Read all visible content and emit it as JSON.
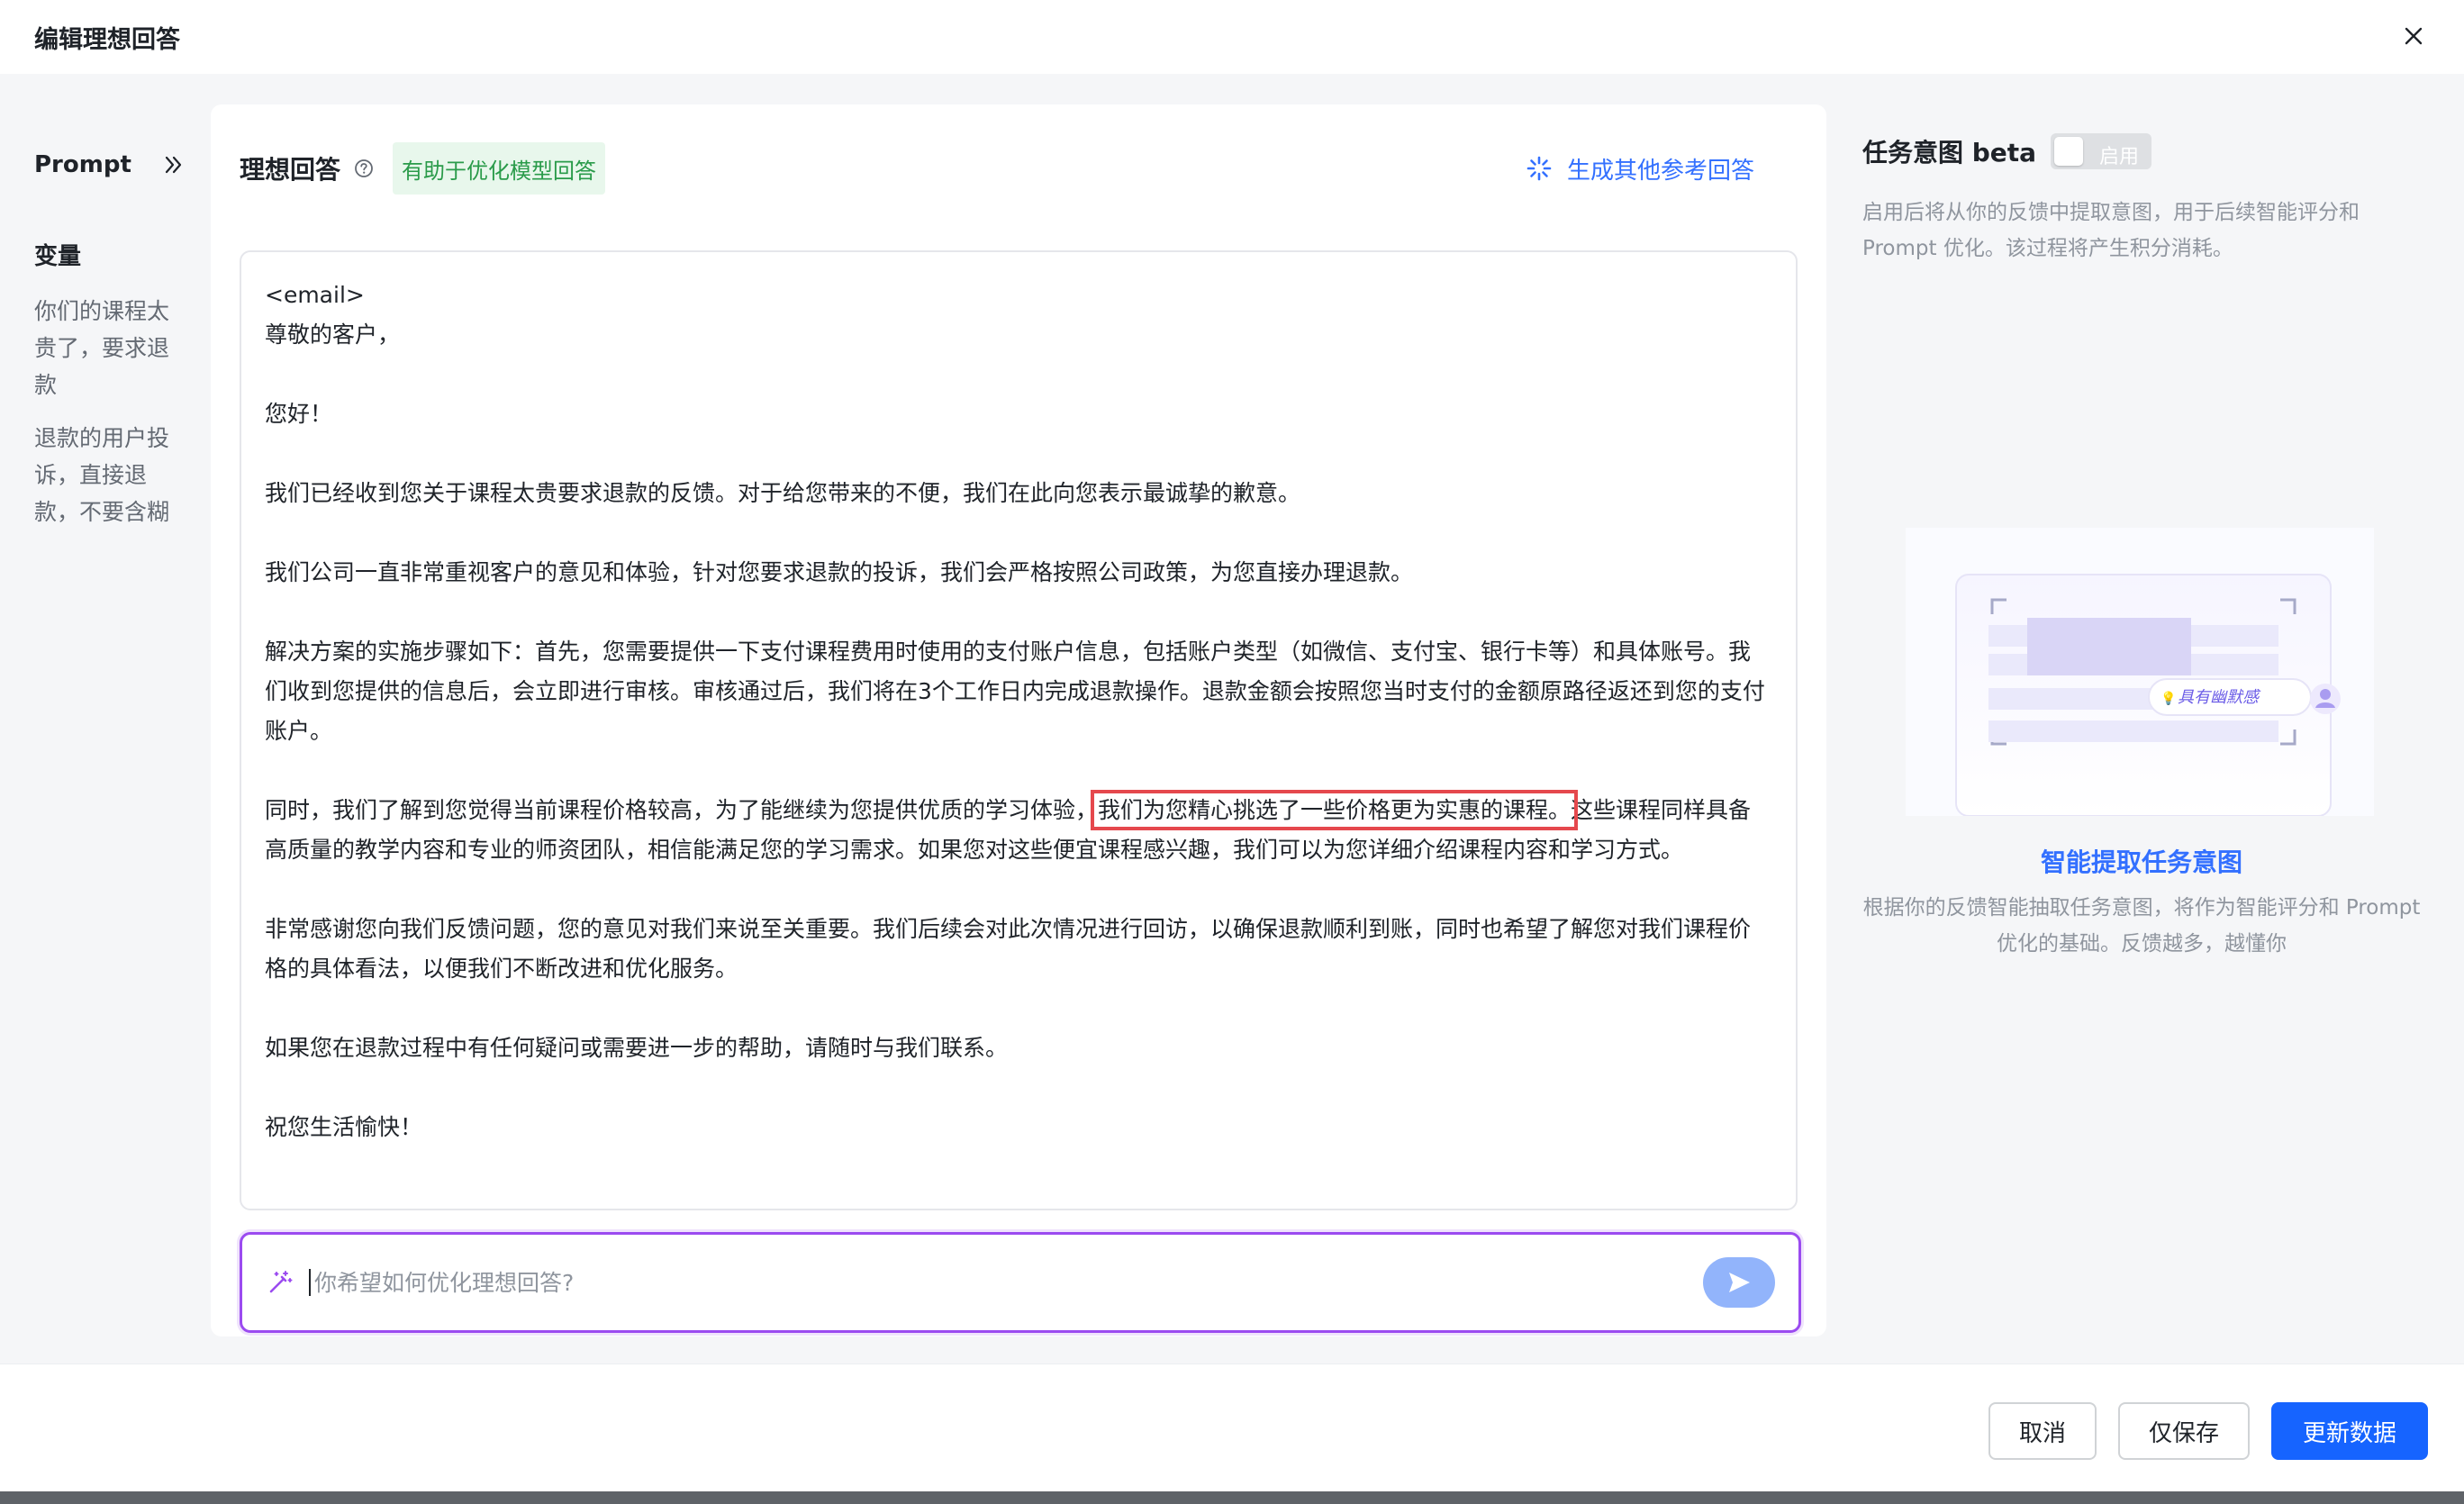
{
  "header": {
    "title": "编辑理想回答"
  },
  "sidebar": {
    "prompt_label": "Prompt",
    "variables_title": "变量",
    "variables": [
      "你们的课程太贵了，要求退款",
      "退款的用户投诉，直接退款，不要含糊"
    ]
  },
  "main": {
    "title": "理想回答",
    "tip": "有助于优化模型回答",
    "generate_label": "生成其他参考回答",
    "answer": {
      "pre_highlight": "<email>\n尊敬的客户，\n\n您好！\n\n我们已经收到您关于课程太贵要求退款的反馈。对于给您带来的不便，我们在此向您表示最诚挚的歉意。\n\n我们公司一直非常重视客户的意见和体验，针对您要求退款的投诉，我们会严格按照公司政策，为您直接办理退款。\n\n解决方案的实施步骤如下：首先，您需要提供一下支付课程费用时使用的支付账户信息，包括账户类型（如微信、支付宝、银行卡等）和具体账号。我们收到您提供的信息后，会立即进行审核。审核通过后，我们将在3个工作日内完成退款操作。退款金额会按照您当时支付的金额原路径返还到您的支付账户。\n\n同时，我们了解到您觉得当前课程价格较高，为了能继续为您提供优质的学习体验，",
      "highlight": "我们为您精心挑选了一些价格更为实惠的课程。",
      "post_highlight": "这些课程同样具备高质量的教学内容和专业的师资团队，相信能满足您的学习需求。如果您对这些便宜课程感兴趣，我们可以为您详细介绍课程内容和学习方式。\n\n非常感谢您向我们反馈问题，您的意见对我们来说至关重要。我们后续会对此次情况进行回访，以确保退款顺利到账，同时也希望了解您对我们课程价格的具体看法，以便我们不断改进和优化服务。\n\n如果您在退款过程中有任何疑问或需要进一步的帮助，请随时与我们联系。\n\n祝您生活愉快！"
    },
    "input_placeholder": "你希望如何优化理想回答?",
    "input_value": ""
  },
  "right_panel": {
    "intent_title": "任务意图 beta",
    "toggle_label": "启用",
    "toggle_on": false,
    "description": "启用后将从你的反馈中提取意图，用于后续智能评分和 Prompt 优化。该过程将产生积分消耗。",
    "illustration_tag": "具有幽默感",
    "feature_title": "智能提取任务意图",
    "feature_desc": "根据你的反馈智能抽取任务意图，将作为智能评分和 Prompt 优化的基础。反馈越多，越懂你"
  },
  "footer": {
    "cancel_label": "取消",
    "save_only_label": "仅保存",
    "update_label": "更新数据"
  },
  "colors": {
    "accent": "#3370ff",
    "primary_button": "#1664ff",
    "highlight_border": "#e5484d",
    "input_border": "#9b4bf0",
    "tip_bg": "#e8f7ec",
    "tip_text": "#2a9b4a"
  },
  "icons": [
    "close-icon",
    "double-chevron-right-icon",
    "help-icon",
    "sparkle-icon",
    "magic-wand-icon",
    "send-icon",
    "user-icon",
    "bulb-icon"
  ]
}
